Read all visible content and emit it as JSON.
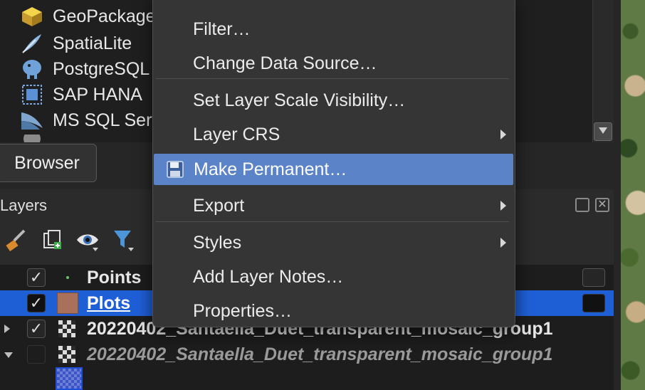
{
  "browser": {
    "items": [
      {
        "label": "GeoPackage",
        "icon": "geopackage-icon"
      },
      {
        "label": "SpatiaLite",
        "icon": "spatialite-feather-icon"
      },
      {
        "label": "PostgreSQL",
        "icon": "postgresql-elephant-icon"
      },
      {
        "label": "SAP HANA",
        "icon": "sap-hana-icon"
      },
      {
        "label": "MS SQL Server",
        "icon": "mssql-icon"
      }
    ],
    "tab_label": "Browser"
  },
  "layers_panel": {
    "title": "Layers",
    "rows": [
      {
        "name": "Points",
        "checked": "✓",
        "selected": false,
        "italic": false
      },
      {
        "name": "Plots",
        "checked": "✓",
        "selected": true,
        "italic": false,
        "fill_color": "#a9715b"
      },
      {
        "name": "20220402_Santaella_Duet_transparent_mosaic_group1",
        "checked": "✓",
        "selected": false,
        "italic": false
      },
      {
        "name": "20220402_Santaella_Duet_transparent_mosaic_group1",
        "checked": "",
        "selected": false,
        "italic": true
      }
    ]
  },
  "context_menu": {
    "items": [
      {
        "label": "Filter…",
        "submenu": false,
        "highlighted": false
      },
      {
        "label": "Change Data Source…",
        "submenu": false,
        "highlighted": false
      },
      {
        "label": "Set Layer Scale Visibility…",
        "submenu": false,
        "highlighted": false
      },
      {
        "label": "Layer CRS",
        "submenu": true,
        "highlighted": false
      },
      {
        "label": "Make Permanent…",
        "submenu": false,
        "highlighted": true,
        "icon": "floppy-disk-icon"
      },
      {
        "label": "Export",
        "submenu": true,
        "highlighted": false
      },
      {
        "label": "Styles",
        "submenu": true,
        "highlighted": false
      },
      {
        "label": "Add Layer Notes…",
        "submenu": false,
        "highlighted": false
      },
      {
        "label": "Properties…",
        "submenu": false,
        "highlighted": false
      }
    ]
  },
  "colors": {
    "selection": "#1f5fd6",
    "menu_highlight": "#5a83c8"
  }
}
